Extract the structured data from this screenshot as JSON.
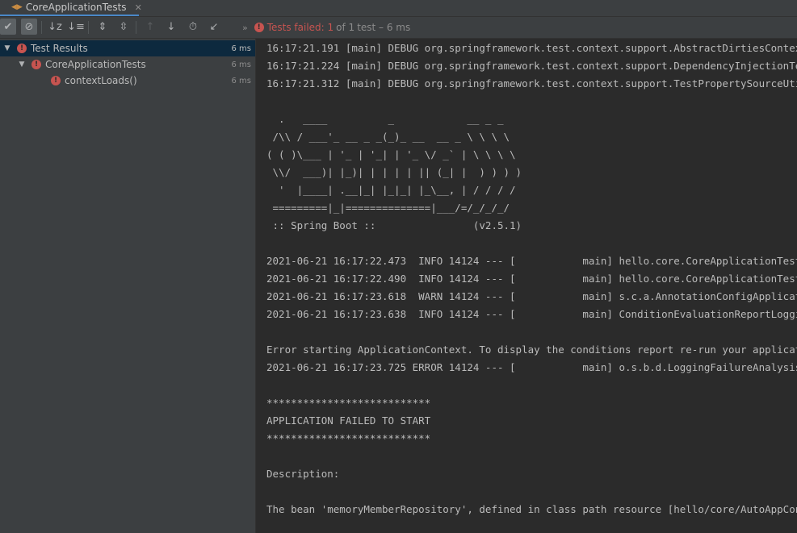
{
  "tab": {
    "title": "CoreApplicationTests",
    "close": "✕"
  },
  "toolbar": {
    "buttons": [
      {
        "name": "show-passed-button",
        "icon": "✔",
        "toggled": true
      },
      {
        "name": "show-ignored-button",
        "icon": "⊘",
        "toggled": true
      },
      {
        "name": "sort-alphabetically-button",
        "icon": "↓z"
      },
      {
        "name": "sort-by-duration-button",
        "icon": "↓≡"
      },
      {
        "name": "expand-all-button",
        "icon": "⇕"
      },
      {
        "name": "collapse-all-button",
        "icon": "⇳"
      },
      {
        "name": "previous-failed-button",
        "icon": "↑",
        "disabled": true
      },
      {
        "name": "next-failed-button",
        "icon": "↓"
      },
      {
        "name": "test-history-button",
        "icon": "⏱"
      },
      {
        "name": "export-results-button",
        "icon": "↙"
      }
    ],
    "more": "»"
  },
  "status": {
    "failed": "Tests failed: 1",
    "of": "of 1",
    "rest": "test – 6 ms"
  },
  "tree": [
    {
      "label": "Test Results",
      "time": "6 ms",
      "level": 0,
      "expanded": true,
      "selected": true
    },
    {
      "label": "CoreApplicationTests",
      "time": "6 ms",
      "level": 1,
      "expanded": true
    },
    {
      "label": "contextLoads()",
      "time": "6 ms",
      "level": 2
    }
  ],
  "console": [
    "16:17:21.191 [main] DEBUG org.springframework.test.context.support.AbstractDirtiesContextTestExecutionListener",
    "16:17:21.224 [main] DEBUG org.springframework.test.context.support.DependencyInjectionTestExecutionListener",
    "16:17:21.312 [main] DEBUG org.springframework.test.context.support.TestPropertySourceUtils",
    "",
    "  .   ____          _            __ _ _",
    " /\\\\ / ___'_ __ _ _(_)_ __  __ _ \\ \\ \\ \\",
    "( ( )\\___ | '_ | '_| | '_ \\/ _` | \\ \\ \\ \\",
    " \\\\/  ___)| |_)| | | | | || (_| |  ) ) ) )",
    "  '  |____| .__|_| |_|_| |_\\__, | / / / /",
    " =========|_|==============|___/=/_/_/_/",
    " :: Spring Boot ::                (v2.5.1)",
    "",
    "2021-06-21 16:17:22.473  INFO 14124 --- [           main] hello.core.CoreApplicationTests",
    "2021-06-21 16:17:22.490  INFO 14124 --- [           main] hello.core.CoreApplicationTests",
    "2021-06-21 16:17:23.618  WARN 14124 --- [           main] s.c.a.AnnotationConfigApplicationContext",
    "2021-06-21 16:17:23.638  INFO 14124 --- [           main] ConditionEvaluationReportLoggingListener",
    "",
    "Error starting ApplicationContext. To display the conditions report re-run your application",
    "2021-06-21 16:17:23.725 ERROR 14124 --- [           main] o.s.b.d.LoggingFailureAnalysisReporter",
    "",
    "***************************",
    "APPLICATION FAILED TO START",
    "***************************",
    "",
    "Description:",
    "",
    "The bean 'memoryMemberRepository', defined in class path resource [hello/core/AutoAppConfig.class]"
  ]
}
